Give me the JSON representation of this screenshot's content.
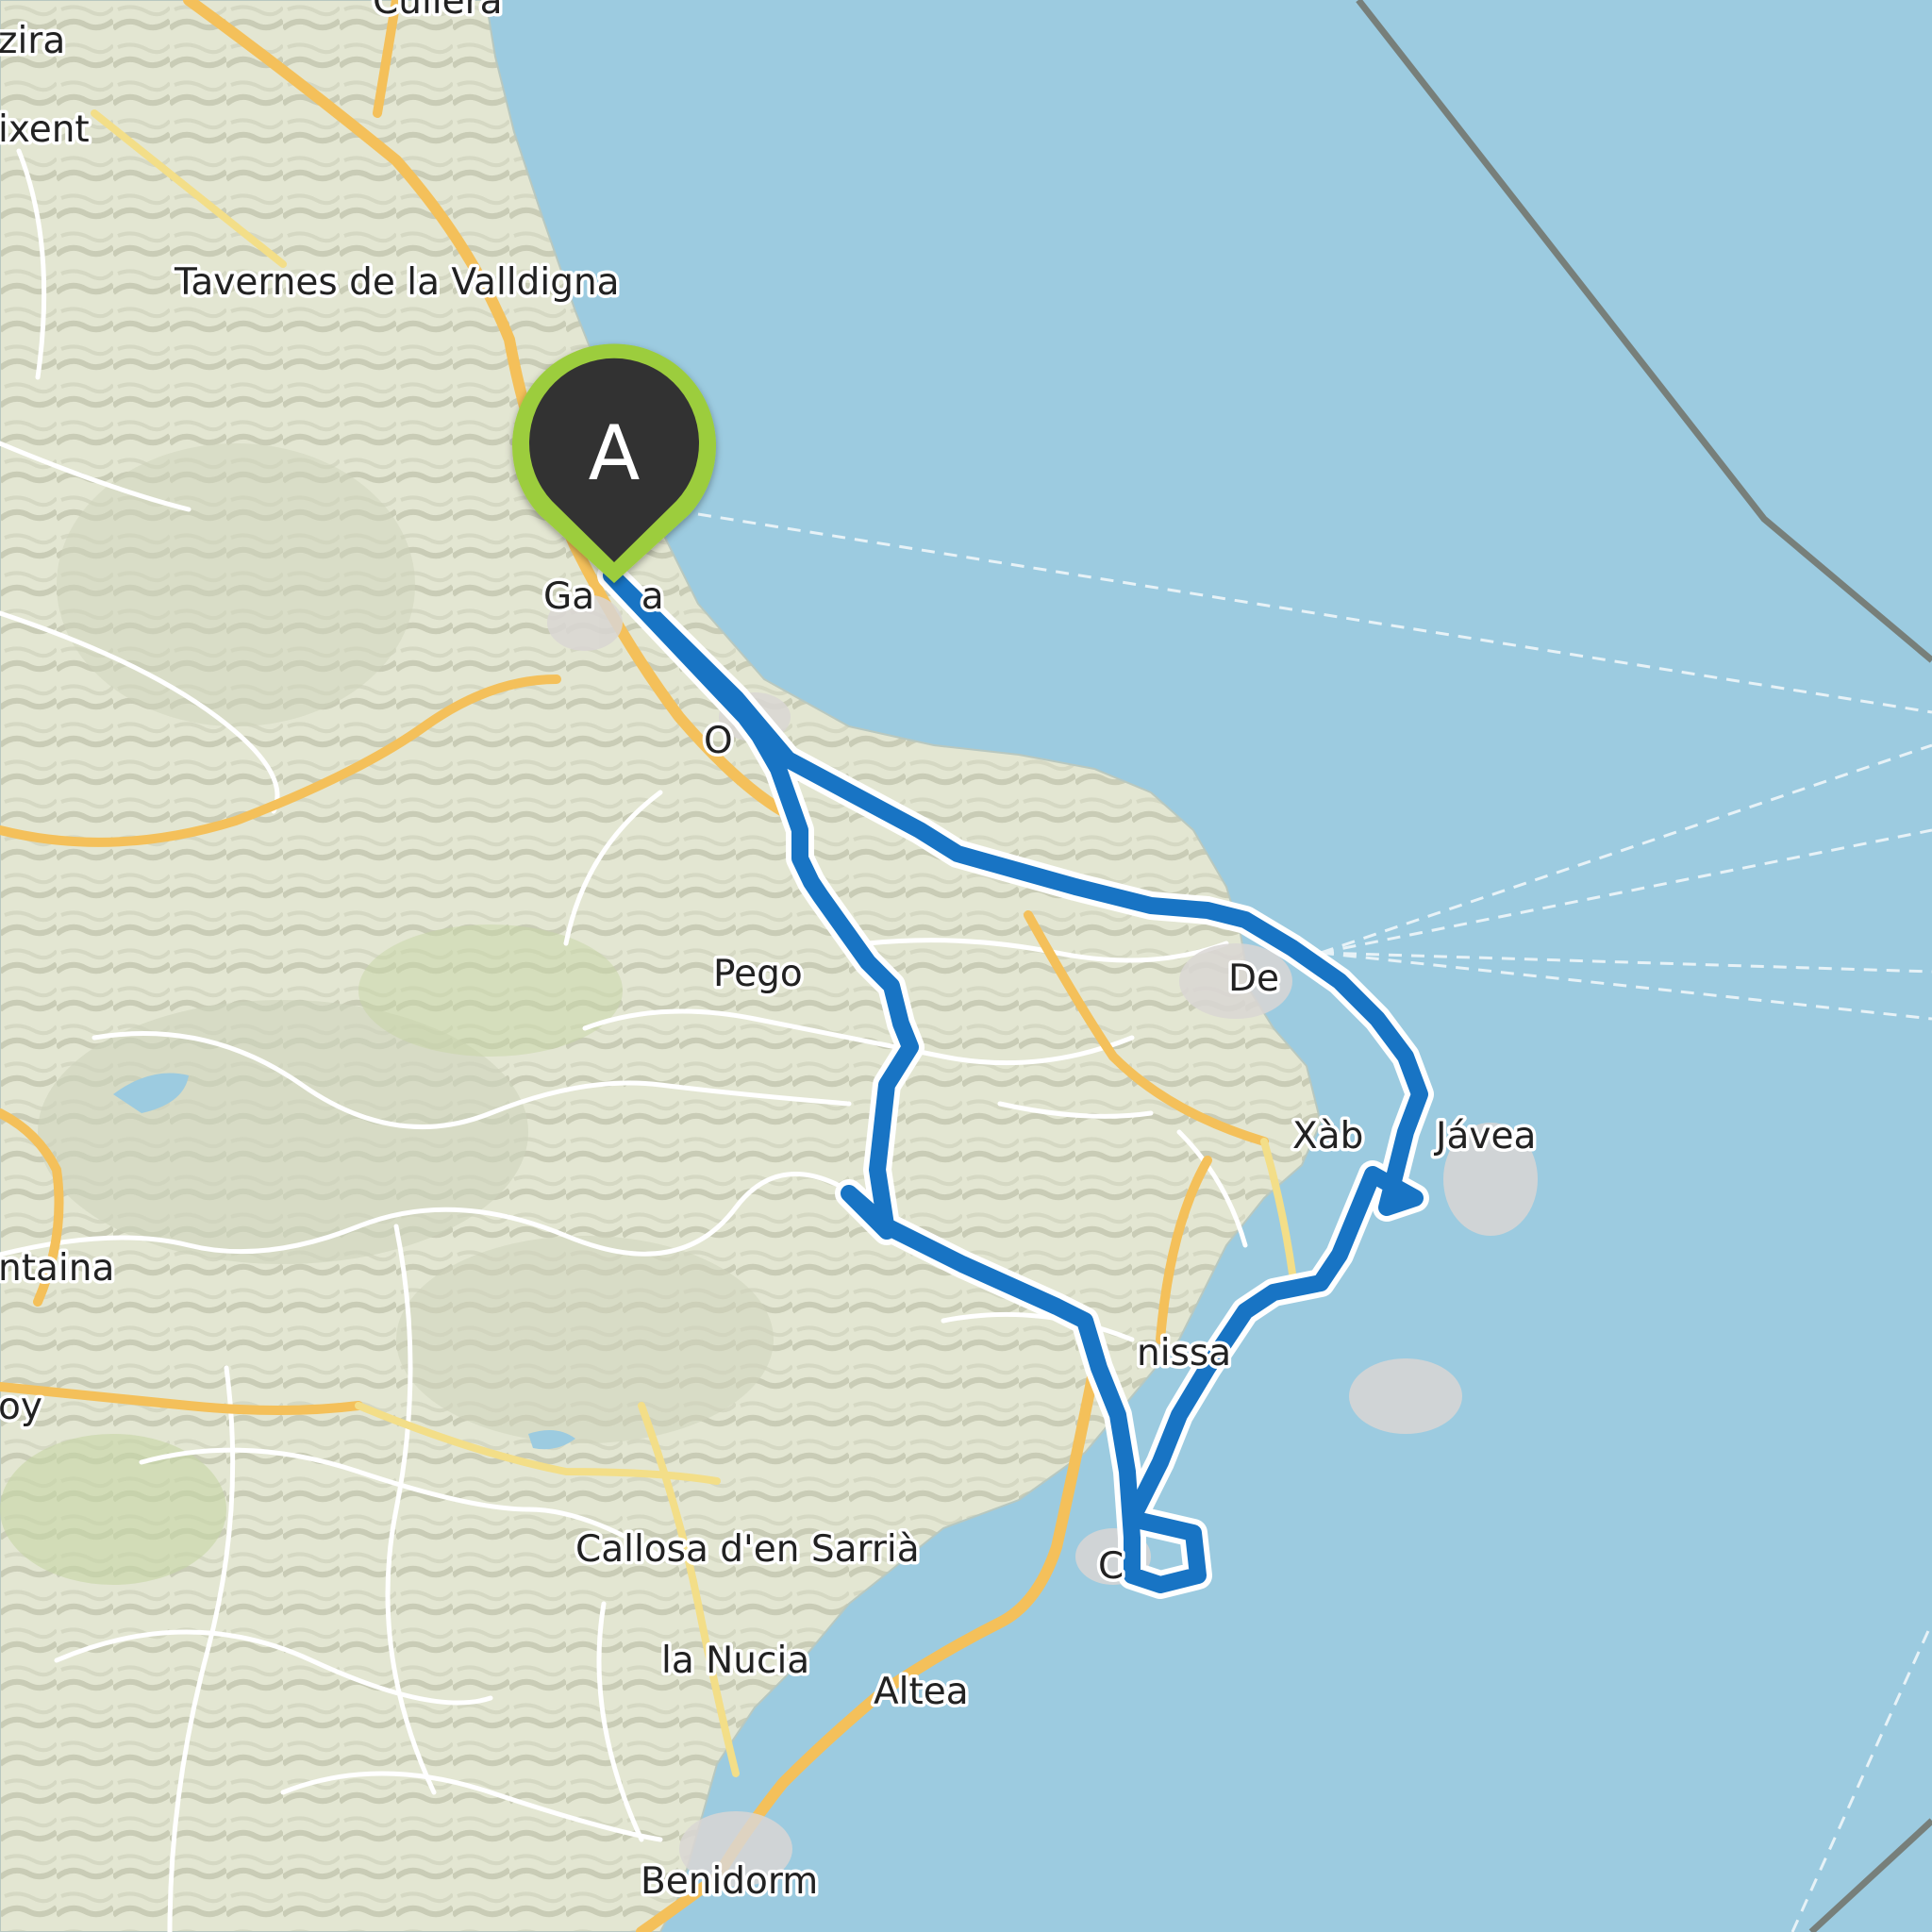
{
  "map": {
    "route_color": "#1874c4",
    "water_color": "#9ccbe0",
    "land_color": "#e4e7d3",
    "marker": {
      "label": "A",
      "fill": "#333333",
      "ring": "#9ccd3c"
    },
    "places": [
      {
        "id": "cullera",
        "name": "Cullera"
      },
      {
        "id": "alzira",
        "name": "zira"
      },
      {
        "id": "xativa",
        "name": "ixent"
      },
      {
        "id": "tavernes",
        "name": "Tavernes de la Valldigna"
      },
      {
        "id": "gandia",
        "name": "Ga    a"
      },
      {
        "id": "oliva",
        "name": "O    "
      },
      {
        "id": "pego",
        "name": "Pego"
      },
      {
        "id": "denia",
        "name": "De"
      },
      {
        "id": "xabia",
        "name": "Xàb"
      },
      {
        "id": "javea",
        "name": "Jávea"
      },
      {
        "id": "ontinyent",
        "name": "ntaina"
      },
      {
        "id": "benissa",
        "name": "nissa"
      },
      {
        "id": "alcoy",
        "name": "oy"
      },
      {
        "id": "calpe",
        "name": "C"
      },
      {
        "id": "callosa",
        "name": "Callosa d'en Sarrià"
      },
      {
        "id": "lanucia",
        "name": "la Nucia"
      },
      {
        "id": "altea",
        "name": "Altea"
      },
      {
        "id": "benidorm",
        "name": "Benidorm"
      }
    ]
  }
}
